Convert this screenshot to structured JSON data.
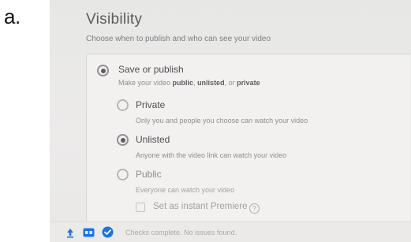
{
  "figure_label": "a.",
  "visibility": {
    "title": "Visibility",
    "subtitle": "Choose when to publish and who can see your video"
  },
  "save_or_publish": {
    "label": "Save or publish",
    "desc_prefix": "Make your video ",
    "desc_public": "public",
    "desc_sep": ", ",
    "desc_unlisted": "unlisted",
    "desc_or": ", or ",
    "desc_private": "private",
    "selected": true
  },
  "options": {
    "private": {
      "label": "Private",
      "desc": "Only you and people you choose can watch your video",
      "selected": false
    },
    "unlisted": {
      "label": "Unlisted",
      "desc": "Anyone with the video link can watch your video",
      "selected": true
    },
    "public": {
      "label": "Public",
      "desc": "Everyone can watch your video",
      "selected": false
    }
  },
  "premiere": {
    "label": "Set as instant Premiere",
    "help_glyph": "?",
    "checked": false
  },
  "footer": {
    "status_text": "Checks complete. No issues found.",
    "icons": [
      "upload-icon",
      "hd-badge-icon",
      "checks-complete-icon"
    ],
    "accent_color": "#1a73e8"
  }
}
